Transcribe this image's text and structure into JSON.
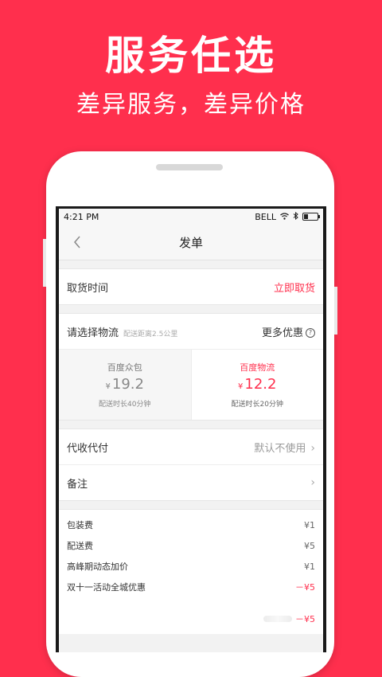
{
  "hero": {
    "title": "服务任选",
    "subtitle": "差异服务，差异价格"
  },
  "status_bar": {
    "time": "4:21 PM",
    "carrier": "BELL",
    "icons": [
      "wifi-icon",
      "bluetooth-icon",
      "battery-icon"
    ]
  },
  "nav": {
    "back_icon": "chevron-left-icon",
    "title": "发单"
  },
  "pickup": {
    "label": "取货时间",
    "value": "立即取货"
  },
  "logistics": {
    "label": "请选择物流",
    "distance": "配送距离2.5公里",
    "more": "更多优惠",
    "options": [
      {
        "name": "百度众包",
        "currency": "¥",
        "price": "19.2",
        "eta": "配送时长40分钟",
        "selected": false
      },
      {
        "name": "百度物流",
        "currency": "¥",
        "price": "12.2",
        "eta": "配送时长20分钟",
        "selected": true
      }
    ]
  },
  "cod": {
    "label": "代收代付",
    "value": "默认不使用"
  },
  "notes": {
    "label": "备注"
  },
  "fees": [
    {
      "label": "包装费",
      "value": "¥1"
    },
    {
      "label": "配送费",
      "value": "¥5"
    },
    {
      "label": "高峰期动态加价",
      "value": "¥1"
    },
    {
      "label": "双十一活动全城优惠",
      "value": "－¥5"
    }
  ],
  "total": {
    "value": "－¥5"
  },
  "colors": {
    "brand": "#ff2f4d",
    "background": "#f2f2f2"
  }
}
